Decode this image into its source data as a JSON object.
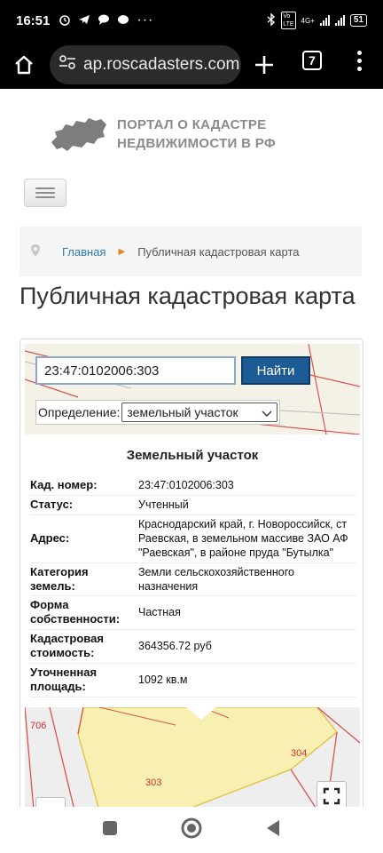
{
  "status_bar": {
    "time": "16:51",
    "battery": "51",
    "network": "4G+"
  },
  "browser": {
    "url": "ap.roscadasters.com",
    "tab_count": "7"
  },
  "site": {
    "logo_line1": "ПОРТАЛ О КАДАСТРЕ",
    "logo_line2": "НЕДВИЖИМОСТИ В РФ"
  },
  "breadcrumb": {
    "home": "Главная",
    "current": "Публичная кадастровая карта"
  },
  "page_title": "Публичная кадастровая карта",
  "map": {
    "search_value": "23:47:0102006:303",
    "find_label": "Найти",
    "definition_label": "Определение:",
    "definition_value": "земельный участок",
    "map_labels": {
      "parcel_706": "706",
      "parcel_304": "304",
      "parcel_303": "303"
    }
  },
  "info": {
    "title": "Земельный участок",
    "rows": [
      {
        "key": "Кад. номер:",
        "value": "23:47:0102006:303"
      },
      {
        "key": "Статус:",
        "value": "Учтенный"
      },
      {
        "key": "Адрес:",
        "value": "Краснодарский край, г. Новороссийск, ст Раевская, в земельном массиве ЗАО АФ \"Раевская\", в районе пруда \"Бутылка\""
      },
      {
        "key": "Категория земель:",
        "value": "Земли сельскохозяйственного назначения"
      },
      {
        "key": "Форма собственности:",
        "value": "Частная"
      },
      {
        "key": "Кадастровая стоимость:",
        "value": "364356.72 руб"
      },
      {
        "key": "Уточненная площадь:",
        "value": "1092 кв.м"
      }
    ]
  }
}
